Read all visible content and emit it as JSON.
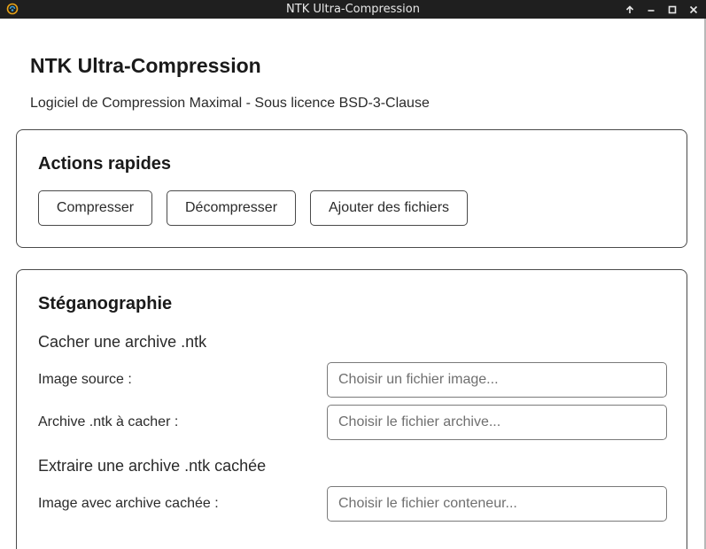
{
  "window": {
    "title": "NTK Ultra-Compression"
  },
  "header": {
    "title": "NTK Ultra-Compression",
    "subtitle": "Logiciel de Compression Maximal - Sous licence BSD-3-Clause"
  },
  "quick_actions": {
    "title": "Actions rapides",
    "buttons": [
      {
        "label": "Compresser"
      },
      {
        "label": "Décompresser"
      },
      {
        "label": "Ajouter des fichiers"
      }
    ]
  },
  "steganography": {
    "title": "Stéganographie",
    "hide": {
      "heading": "Cacher une archive .ntk",
      "source_label": "Image source :",
      "source_placeholder": "Choisir un fichier image...",
      "archive_label": "Archive .ntk à cacher :",
      "archive_placeholder": "Choisir le fichier archive..."
    },
    "extract": {
      "heading": "Extraire une archive .ntk cachée",
      "container_label": "Image avec archive cachée :",
      "container_placeholder": "Choisir le fichier conteneur..."
    }
  },
  "colors": {
    "titlebar_bg": "#1f1f1f",
    "app_icon": "#e8a317",
    "border": "#4a4a4a"
  }
}
